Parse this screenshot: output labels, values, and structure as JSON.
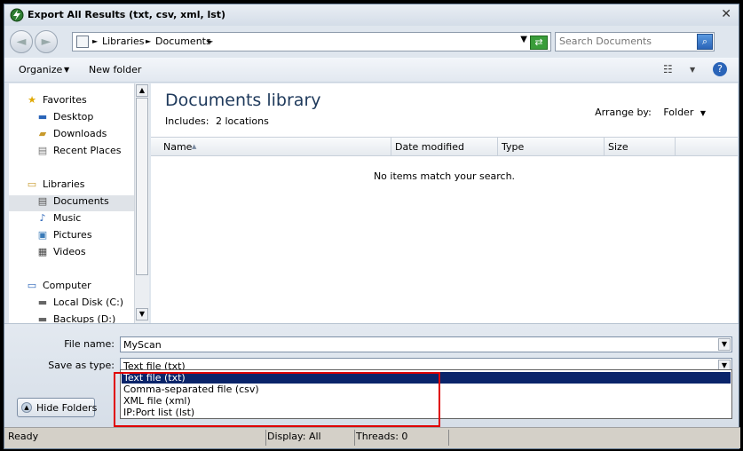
{
  "window": {
    "title": "Export All Results (txt, csv, xml, lst)",
    "close_label": "✕"
  },
  "nav": {
    "back_label": "◄",
    "forward_label": "►",
    "breadcrumbs": [
      "Libraries",
      "Documents"
    ],
    "separator": "►",
    "dropdown": "▼",
    "search_placeholder": "Search Documents",
    "refresh_label": "⇄",
    "search_btn": "⌕"
  },
  "toolbar": {
    "organize_label": "Organize",
    "organize_arrow": "▼",
    "new_folder_label": "New folder",
    "views_icon": "☷",
    "views_arrow": "▼",
    "help_icon": "?"
  },
  "sidebar": {
    "favorites_header": "Favorites",
    "favorites": [
      "Desktop",
      "Downloads",
      "Recent Places"
    ],
    "libraries_header": "Libraries",
    "libraries": [
      "Documents",
      "Music",
      "Pictures",
      "Videos"
    ],
    "computer_header": "Computer",
    "computer": [
      "Local Disk (C:)",
      "Backups (D:)"
    ],
    "scroll_up": "▲",
    "scroll_down": "▼"
  },
  "content": {
    "title": "Documents library",
    "includes_label": "Includes:",
    "includes_value": "2 locations",
    "arrange_label": "Arrange by:",
    "arrange_value": "Folder",
    "arrange_arrow": "▼",
    "columns": [
      "Name",
      "Date modified",
      "Type",
      "Size"
    ],
    "sort_indicator": "▲",
    "empty_message": "No items match your search."
  },
  "form": {
    "file_name_label": "File name:",
    "file_name_value": "MyScan",
    "save_type_label": "Save as type:",
    "save_type_value": "Text file (txt)",
    "options": [
      "Text file (txt)",
      "Comma-separated file (csv)",
      "XML file (xml)",
      "IP:Port list (lst)"
    ],
    "combo_arrow": "▼"
  },
  "hide_folders_label": "Hide Folders",
  "hide_folders_icon": "▲",
  "status": {
    "state": "Ready",
    "display": "Display: All",
    "threads": "Threads: 0"
  }
}
